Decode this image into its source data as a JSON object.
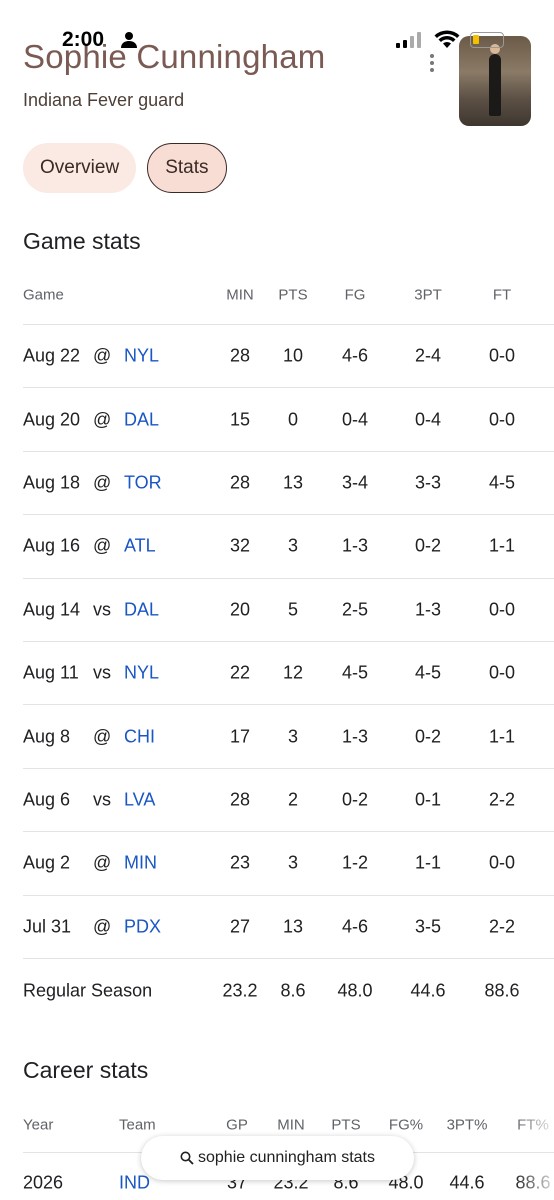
{
  "status": {
    "time": "2:00"
  },
  "header": {
    "name": "Sophie Cunningham",
    "subtitle": "Indiana Fever guard"
  },
  "tabs": [
    {
      "label": "Overview"
    },
    {
      "label": "Stats"
    }
  ],
  "game_stats": {
    "title": "Game stats",
    "columns": [
      "Game",
      "MIN",
      "PTS",
      "FG",
      "3PT",
      "FT"
    ],
    "rows": [
      {
        "date": "Aug 22",
        "loc": "@",
        "opp": "NYL",
        "min": "28",
        "pts": "10",
        "fg": "4-6",
        "tpt": "2-4",
        "ft": "0-0"
      },
      {
        "date": "Aug 20",
        "loc": "@",
        "opp": "DAL",
        "min": "15",
        "pts": "0",
        "fg": "0-4",
        "tpt": "0-4",
        "ft": "0-0"
      },
      {
        "date": "Aug 18",
        "loc": "@",
        "opp": "TOR",
        "min": "28",
        "pts": "13",
        "fg": "3-4",
        "tpt": "3-3",
        "ft": "4-5"
      },
      {
        "date": "Aug 16",
        "loc": "@",
        "opp": "ATL",
        "min": "32",
        "pts": "3",
        "fg": "1-3",
        "tpt": "0-2",
        "ft": "1-1"
      },
      {
        "date": "Aug 14",
        "loc": "vs",
        "opp": "DAL",
        "min": "20",
        "pts": "5",
        "fg": "2-5",
        "tpt": "1-3",
        "ft": "0-0"
      },
      {
        "date": "Aug 11",
        "loc": "vs",
        "opp": "NYL",
        "min": "22",
        "pts": "12",
        "fg": "4-5",
        "tpt": "4-5",
        "ft": "0-0"
      },
      {
        "date": "Aug 8",
        "loc": "@",
        "opp": "CHI",
        "min": "17",
        "pts": "3",
        "fg": "1-3",
        "tpt": "0-2",
        "ft": "1-1"
      },
      {
        "date": "Aug 6",
        "loc": "vs",
        "opp": "LVA",
        "min": "28",
        "pts": "2",
        "fg": "0-2",
        "tpt": "0-1",
        "ft": "2-2"
      },
      {
        "date": "Aug 2",
        "loc": "@",
        "opp": "MIN",
        "min": "23",
        "pts": "3",
        "fg": "1-2",
        "tpt": "1-1",
        "ft": "0-0"
      },
      {
        "date": "Jul 31",
        "loc": "@",
        "opp": "PDX",
        "min": "27",
        "pts": "13",
        "fg": "4-6",
        "tpt": "3-5",
        "ft": "2-2"
      }
    ],
    "season": {
      "label": "Regular Season",
      "min": "23.2",
      "pts": "8.6",
      "fg": "48.0",
      "tpt": "44.6",
      "ft": "88.6"
    }
  },
  "career_stats": {
    "title": "Career stats",
    "columns": [
      "Year",
      "Team",
      "GP",
      "MIN",
      "PTS",
      "FG%",
      "3PT%",
      "FT%"
    ],
    "rows": [
      {
        "year": "2026",
        "team": "IND",
        "gp": "37",
        "min": "23.2",
        "pts": "8.6",
        "fg": "48.0",
        "tpt": "44.6",
        "ft": "88.6"
      }
    ]
  },
  "search": {
    "query": "sophie cunningham stats"
  },
  "colors": {
    "accent_link": "#1a56c4",
    "chip_bg": "#fbe9e4",
    "chip_selected_bg": "#f8ddd5",
    "name_color": "#7a5a52"
  }
}
